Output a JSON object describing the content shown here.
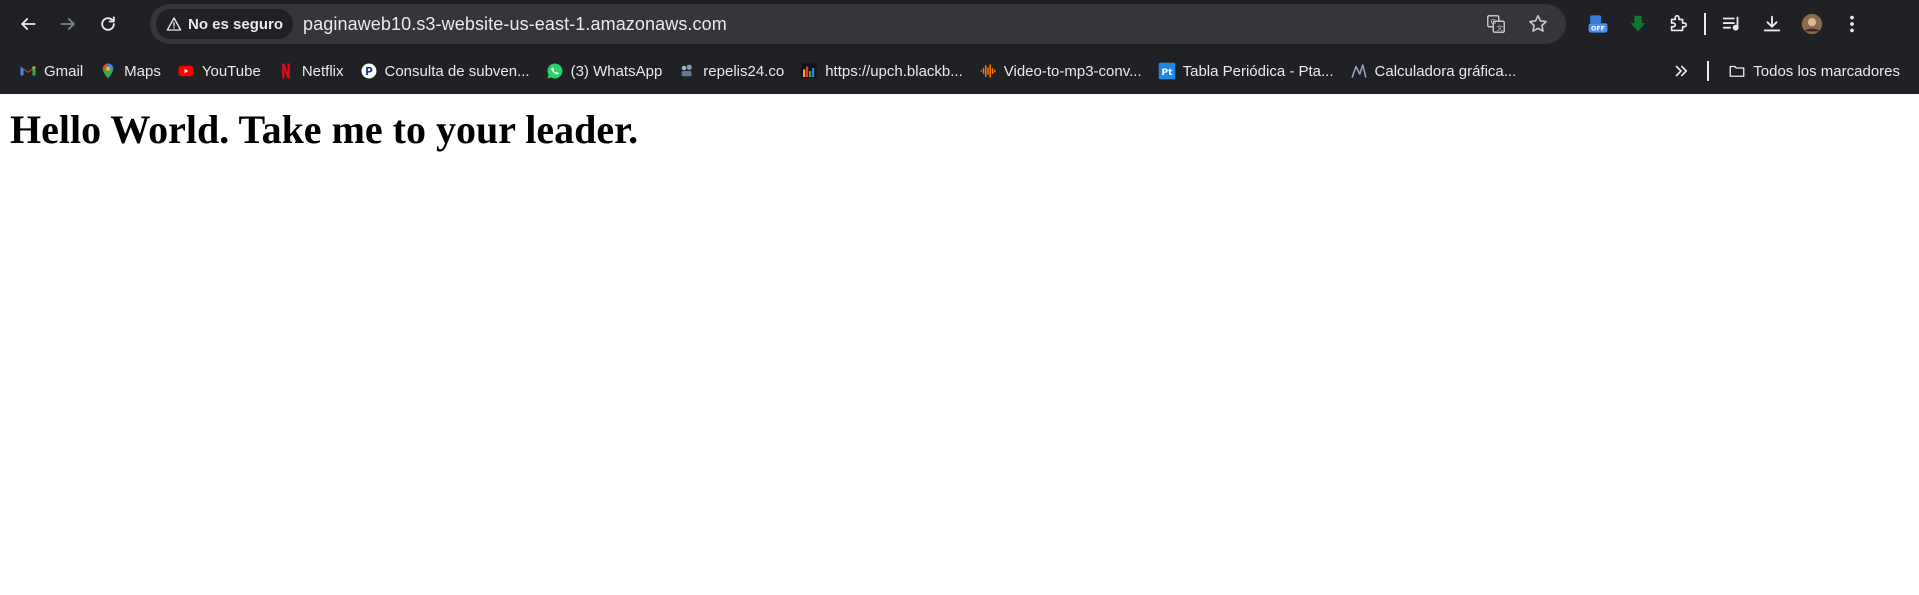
{
  "browser": {
    "security_label": "No es seguro",
    "url": "paginaweb10.s3-website-us-east-1.amazonaws.com",
    "extension_badge": "OFF",
    "bookmarks": [
      {
        "label": "Gmail",
        "icon": "gmail-icon"
      },
      {
        "label": "Maps",
        "icon": "maps-icon"
      },
      {
        "label": "YouTube",
        "icon": "youtube-icon"
      },
      {
        "label": "Netflix",
        "icon": "netflix-icon"
      },
      {
        "label": "Consulta de subven...",
        "icon": "p-circle-icon"
      },
      {
        "label": "(3) WhatsApp",
        "icon": "whatsapp-icon"
      },
      {
        "label": "repelis24.co",
        "icon": "repelis-icon"
      },
      {
        "label": "https://upch.blackb...",
        "icon": "blackboard-icon"
      },
      {
        "label": "Video-to-mp3-conv...",
        "icon": "audio-wave-icon"
      },
      {
        "label": "Tabla Periódica - Pta...",
        "icon": "pt-icon"
      },
      {
        "label": "Calculadora gráfica...",
        "icon": "graph-icon"
      }
    ],
    "all_bookmarks_label": "Todos los marcadores"
  },
  "page": {
    "heading": "Hello World. Take me to your leader."
  },
  "colors": {
    "chrome_bg": "#202124",
    "omnibox_bg": "#35363a",
    "text_light": "#e8eaed",
    "page_bg": "#ffffff"
  }
}
